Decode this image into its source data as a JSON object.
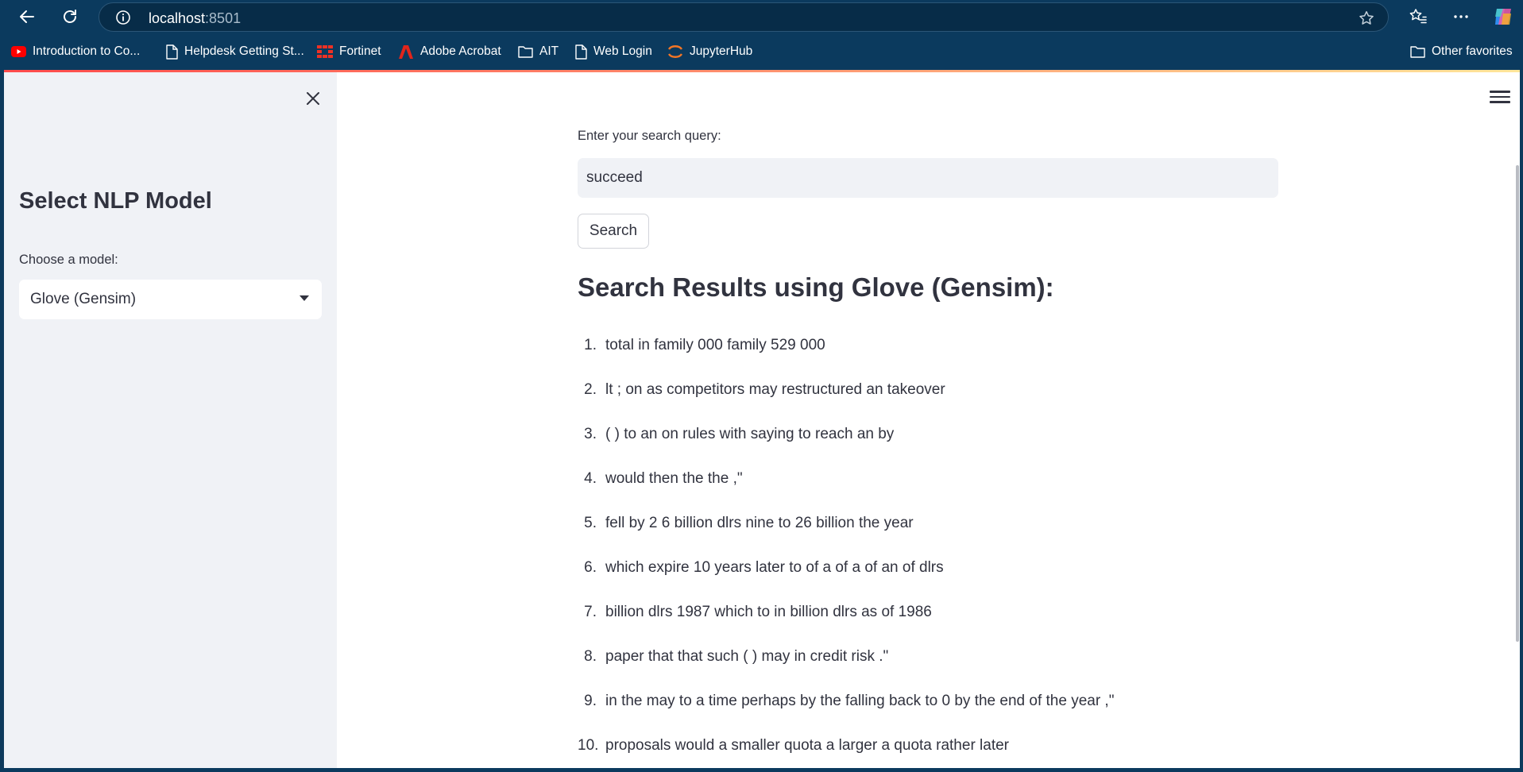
{
  "browser": {
    "url_host": "localhost",
    "url_port": ":8501",
    "icons": [
      "back-arrow-icon",
      "refresh-icon",
      "info-icon",
      "star-icon",
      "favorites-icon",
      "more-icon",
      "copilot-icon"
    ]
  },
  "bookmarks": [
    {
      "label": "Introduction to Co...",
      "icon": "youtube-icon"
    },
    {
      "label": "Helpdesk Getting St...",
      "icon": "page-icon"
    },
    {
      "label": "Fortinet",
      "icon": "fortinet-icon"
    },
    {
      "label": "Adobe Acrobat",
      "icon": "acrobat-icon"
    },
    {
      "label": "AIT",
      "icon": "folder-icon"
    },
    {
      "label": "Web Login",
      "icon": "page-icon"
    },
    {
      "label": "JupyterHub",
      "icon": "jupyter-icon"
    },
    {
      "label": "Other favorites",
      "icon": "folder-icon"
    }
  ],
  "sidebar": {
    "title": "Select NLP Model",
    "model_label": "Choose a model:",
    "model_selected": "Glove (Gensim)"
  },
  "main": {
    "query_label": "Enter your search query:",
    "query_value": "succeed",
    "search_button": "Search",
    "results_title": "Search Results using Glove (Gensim):",
    "results": [
      {
        "num": "1.",
        "text": "total in family 000 family 529 000"
      },
      {
        "num": "2.",
        "text": "lt ; on as competitors may restructured an takeover"
      },
      {
        "num": "3.",
        "text": "( ) to an on rules with saying to reach an by"
      },
      {
        "num": "4.",
        "text": "would then the the ,\""
      },
      {
        "num": "5.",
        "text": "fell by 2 6 billion dlrs nine to 26 billion the year"
      },
      {
        "num": "6.",
        "text": "which expire 10 years later to of a of a of an of dlrs"
      },
      {
        "num": "7.",
        "text": "billion dlrs 1987 which to in billion dlrs as of 1986"
      },
      {
        "num": "8.",
        "text": "paper that that such ( ) may in credit risk .\""
      },
      {
        "num": "9.",
        "text": "in the may to a time perhaps by the falling back to 0 by the end of the year ,\""
      },
      {
        "num": "10.",
        "text": "proposals would a smaller quota a larger a quota rather later"
      }
    ]
  },
  "colors": {
    "chrome": "#0b3a5e",
    "sidebar_bg": "#f0f2f6",
    "text": "#31333f",
    "accent_start": "#ff4b4b",
    "accent_end": "#ffe69a"
  }
}
